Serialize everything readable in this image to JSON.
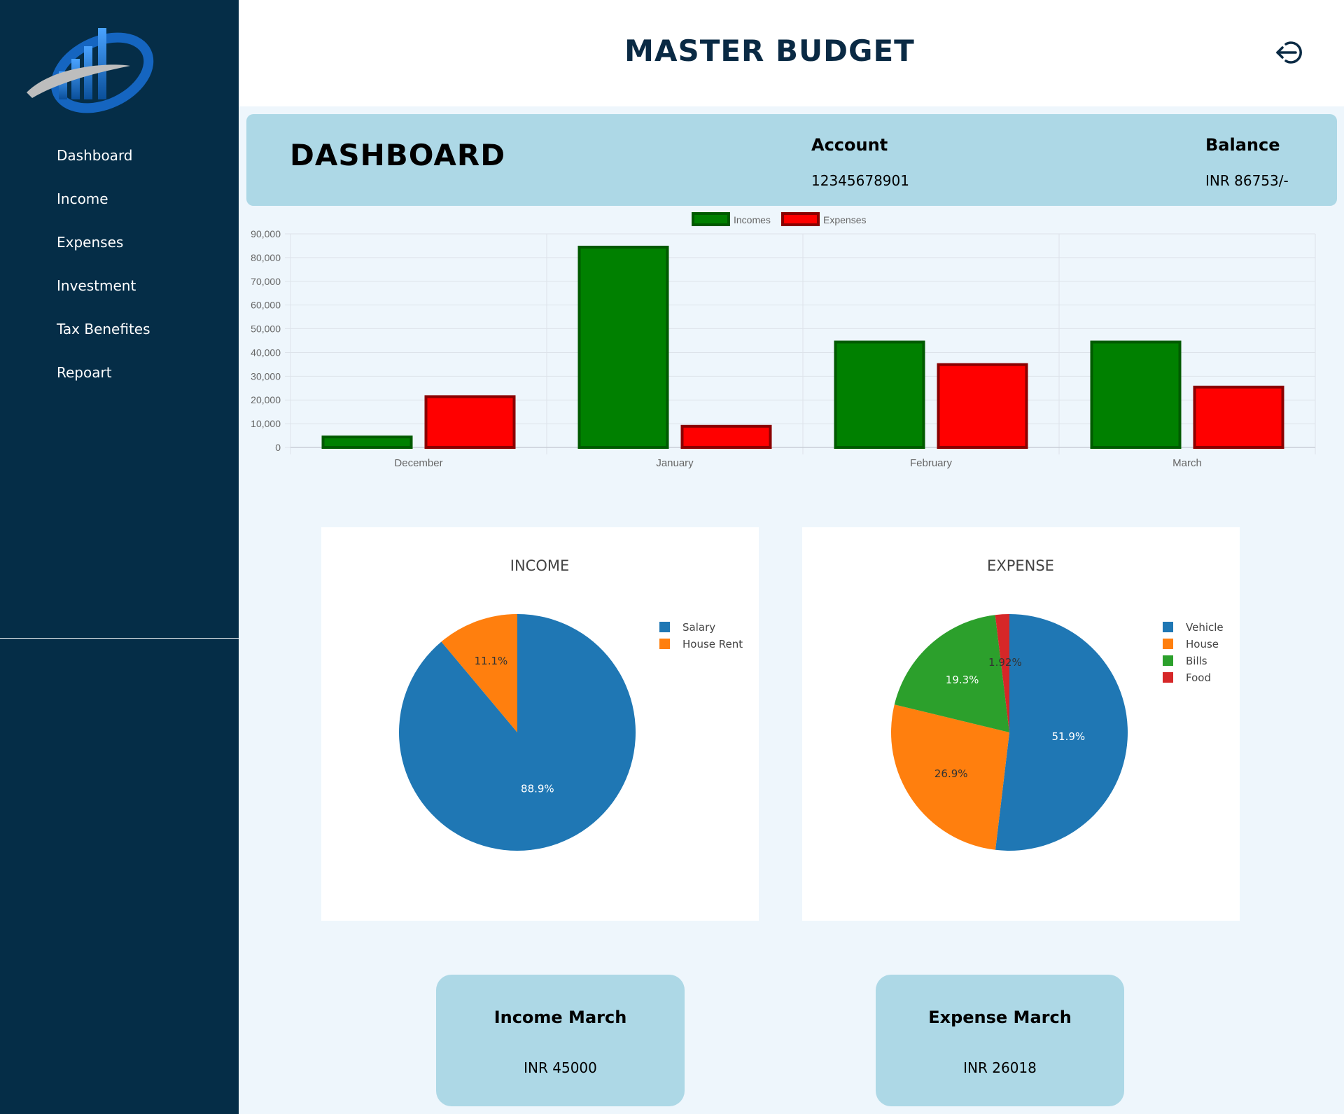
{
  "header": {
    "title": "MASTER BUDGET",
    "logout_icon": "logout-icon"
  },
  "sidebar": {
    "logo_icon": "bar-chart-swoosh-logo",
    "items": [
      {
        "label": "Dashboard"
      },
      {
        "label": "Income"
      },
      {
        "label": "Expenses"
      },
      {
        "label": "Investment"
      },
      {
        "label": "Tax Benefites"
      },
      {
        "label": "Repoart"
      }
    ]
  },
  "info": {
    "title": "DASHBOARD",
    "account_label": "Account",
    "account_value": "12345678901",
    "balance_label": "Balance",
    "balance_value": "INR 86753/-"
  },
  "summary": {
    "income_title": "Income March",
    "income_value": "INR 45000",
    "expense_title": "Expense March",
    "expense_value": "INR 26018"
  },
  "colors": {
    "sidebar": "#052d47",
    "band": "#add8e6",
    "income_bar": "#008000",
    "expense_bar": "#ff0000",
    "pie_blue": "#1f77b4",
    "pie_orange": "#ff7f0e",
    "pie_green": "#2ca02c",
    "pie_red": "#d62728"
  },
  "chart_data": [
    {
      "type": "bar",
      "categories": [
        "December",
        "January",
        "February",
        "March"
      ],
      "series": [
        {
          "name": "Incomes",
          "values": [
            5000,
            85000,
            45000,
            45000
          ],
          "color": "#008000",
          "border": "#005a00"
        },
        {
          "name": "Expenses",
          "values": [
            22000,
            9500,
            35500,
            26018
          ],
          "color": "#ff0000",
          "border": "#8b0000"
        }
      ],
      "ylim": [
        0,
        90000
      ],
      "yticks": [
        0,
        10000,
        20000,
        30000,
        40000,
        50000,
        60000,
        70000,
        80000,
        90000
      ],
      "ytick_labels": [
        "0",
        "10,000",
        "20,000",
        "30,000",
        "40,000",
        "50,000",
        "60,000",
        "70,000",
        "80,000",
        "90,000"
      ],
      "legend": "top-center",
      "grid": true
    },
    {
      "type": "pie",
      "title": "INCOME",
      "labels": [
        "Salary",
        "House Rent"
      ],
      "values": [
        88.9,
        11.1
      ],
      "percent_labels": [
        "88.9%",
        "11.1%"
      ],
      "colors": [
        "#1f77b4",
        "#ff7f0e"
      ],
      "legend": "top-right"
    },
    {
      "type": "pie",
      "title": "EXPENSE",
      "labels": [
        "Vehicle",
        "House",
        "Bills",
        "Food"
      ],
      "values": [
        51.9,
        26.9,
        19.3,
        1.92
      ],
      "percent_labels": [
        "51.9%",
        "26.9%",
        "19.3%",
        "1.92%"
      ],
      "colors": [
        "#1f77b4",
        "#ff7f0e",
        "#2ca02c",
        "#d62728"
      ],
      "legend": "top-right"
    }
  ]
}
